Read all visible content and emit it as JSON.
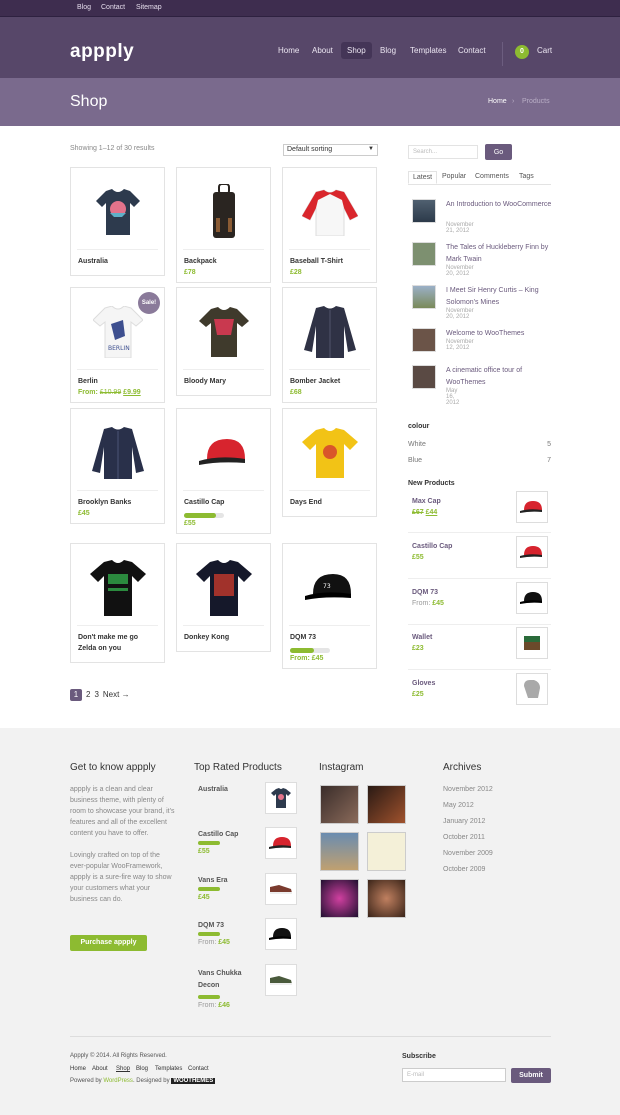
{
  "topbar": {
    "links": [
      "Blog",
      "Contact",
      "Sitemap"
    ]
  },
  "header": {
    "logo": "appply",
    "nav": [
      "Home",
      "About",
      "Shop",
      "Blog",
      "Templates",
      "Contact"
    ],
    "cart_count": "0",
    "cart_label": "Cart"
  },
  "titlebar": {
    "title": "Shop",
    "breadcrumb_home": "Home",
    "breadcrumb_sep": "›",
    "breadcrumb_current": "Products"
  },
  "shop": {
    "result_count": "Showing 1–12 of 30 results",
    "sort_value": "Default sorting",
    "products": [
      {
        "name": "Australia",
        "price": "",
        "rating": false
      },
      {
        "name": "Backpack",
        "price": "£78",
        "rating": false
      },
      {
        "name": "Baseball T-Shirt",
        "price": "£28",
        "rating": false
      },
      {
        "name": "Berlin",
        "price_prefix": "From:",
        "old_price": "£10.99",
        "price": "£9.99",
        "sale": "Sale!"
      },
      {
        "name": "Bloody Mary",
        "price": ""
      },
      {
        "name": "Bomber Jacket",
        "price": "£68"
      },
      {
        "name": "Brooklyn Banks",
        "price": "£45"
      },
      {
        "name": "Castillo Cap",
        "price": "£55",
        "rating": true
      },
      {
        "name": "Days End",
        "price": ""
      },
      {
        "name": "Don't make me go Zelda on you",
        "price": ""
      },
      {
        "name": "Donkey Kong",
        "price": ""
      },
      {
        "name": "DQM 73",
        "price": "From: £45",
        "rating": true
      }
    ],
    "pagination": [
      "1",
      "2",
      "3",
      "Next →"
    ]
  },
  "sidebar": {
    "search_placeholder": "Search...",
    "go_label": "Go",
    "tabs": [
      "Latest",
      "Popular",
      "Comments",
      "Tags"
    ],
    "posts": [
      {
        "title": "An Introduction to WooCommerce",
        "date": "November 21, 2012"
      },
      {
        "title": "The Tales of Huckleberry Finn by Mark Twain",
        "date": "November 20, 2012"
      },
      {
        "title": "I Meet Sir Henry Curtis – King Solomon's Mines",
        "date": "November 20, 2012"
      },
      {
        "title": "Welcome to WooThemes",
        "date": "November 12, 2012"
      },
      {
        "title": "A cinematic office tour of WooThemes",
        "date": "May 16, 2012"
      }
    ],
    "colour_title": "colour",
    "colours": [
      {
        "name": "White",
        "count": "5"
      },
      {
        "name": "Blue",
        "count": "7"
      }
    ],
    "new_title": "New Products",
    "new_products": [
      {
        "name": "Max Cap",
        "old_price": "£67",
        "price": "£44"
      },
      {
        "name": "Castillo Cap",
        "price": "£55"
      },
      {
        "name": "DQM 73",
        "price_prefix": "From:",
        "price": "£45"
      },
      {
        "name": "Wallet",
        "price": "£23"
      },
      {
        "name": "Gloves",
        "price": "£25"
      }
    ]
  },
  "footer": {
    "about_title": "Get to know appply",
    "about_p1": "appply is a clean and clear business theme, with plenty of room to showcase your brand, it's features and all of the excellent content you have to offer.",
    "about_p2": "Lovingly crafted on top of the ever-popular WooFramework, appply is a sure-fire way to show your customers what your business can do.",
    "buy_label": "Purchase appply",
    "toprated_title": "Top Rated Products",
    "toprated": [
      {
        "name": "Australia",
        "price": ""
      },
      {
        "name": "Castillo Cap",
        "price": "£55"
      },
      {
        "name": "Vans Era",
        "price": "£45"
      },
      {
        "name": "DQM 73",
        "price_prefix": "From:",
        "price": "£45"
      },
      {
        "name": "Vans Chukka Decon",
        "price_prefix": "From:",
        "price": "£46"
      }
    ],
    "instagram_title": "Instagram",
    "archives_title": "Archives",
    "archives": [
      "November 2012",
      "May 2012",
      "January 2012",
      "October 2011",
      "November 2009",
      "October 2009"
    ],
    "copyright": "Appply © 2014. All Rights Reserved.",
    "links": [
      "Home",
      "About",
      "Shop",
      "Blog",
      "Templates",
      "Contact"
    ],
    "powered_prefix": "Powered by",
    "powered_link": "WordPress",
    "designed_by": ". Designed by",
    "woo_logo": "WOOTHEMES",
    "subscribe_title": "Subscribe",
    "email_placeholder": "E-mail",
    "submit_label": "Submit"
  },
  "colors": {
    "accent": "#8dbb31",
    "purple": "#6a5a7d",
    "header": "#574769"
  }
}
